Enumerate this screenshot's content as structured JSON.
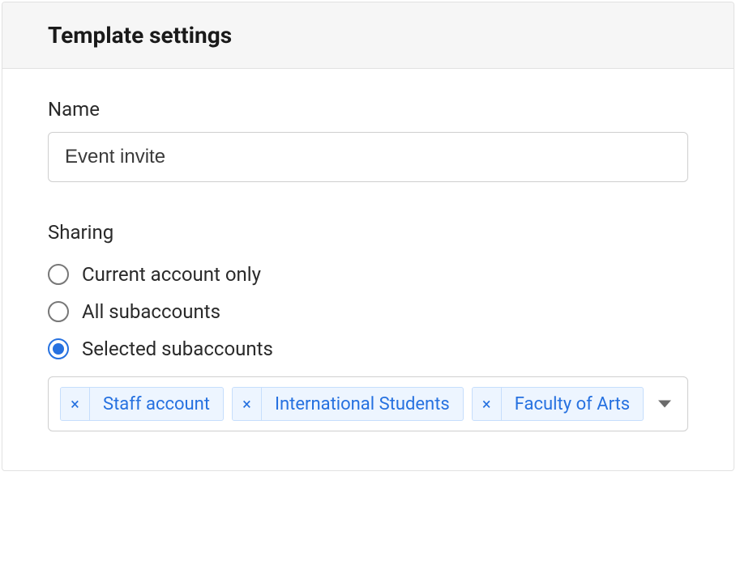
{
  "header": {
    "title": "Template settings"
  },
  "name_field": {
    "label": "Name",
    "value": "Event invite"
  },
  "sharing": {
    "label": "Sharing",
    "options": [
      {
        "label": "Current account only",
        "selected": false
      },
      {
        "label": "All subaccounts",
        "selected": false
      },
      {
        "label": "Selected subaccounts",
        "selected": true
      }
    ],
    "selected_subaccounts": [
      {
        "label": "Staff account"
      },
      {
        "label": "International Students"
      },
      {
        "label": "Faculty of Arts"
      }
    ]
  }
}
